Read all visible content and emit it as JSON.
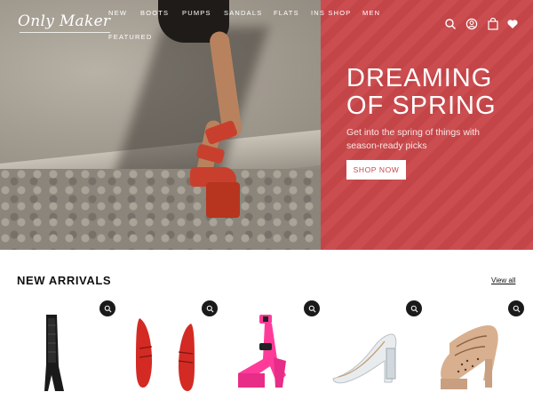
{
  "brand": {
    "logo_text": "Only Maker"
  },
  "nav": {
    "items": [
      "NEW",
      "BOOTS",
      "PUMPS",
      "SANDALS",
      "FLATS",
      "INS SHOP",
      "MEN",
      "FEATURED"
    ]
  },
  "header_icons": [
    "search-icon",
    "account-icon",
    "cart-icon",
    "wishlist-heart-icon"
  ],
  "hero": {
    "title_line1": "DREAMING",
    "title_line2": "OF SPRING",
    "subtitle": "Get into the spring of things with season-ready picks",
    "button_label": "SHOP NOW",
    "panel_color": "#c9474a"
  },
  "new_arrivals": {
    "title": "NEW ARRIVALS",
    "view_all_label": "View all",
    "products": [
      {
        "name": "black-lace-knee-boot",
        "icon": "quick-view-icon"
      },
      {
        "name": "red-patent-flat",
        "icon": "quick-view-icon"
      },
      {
        "name": "pink-platform-heel",
        "icon": "quick-view-icon"
      },
      {
        "name": "clear-block-heel-pump",
        "icon": "quick-view-icon"
      },
      {
        "name": "nude-polka-mary-jane",
        "icon": "quick-view-icon"
      }
    ]
  }
}
